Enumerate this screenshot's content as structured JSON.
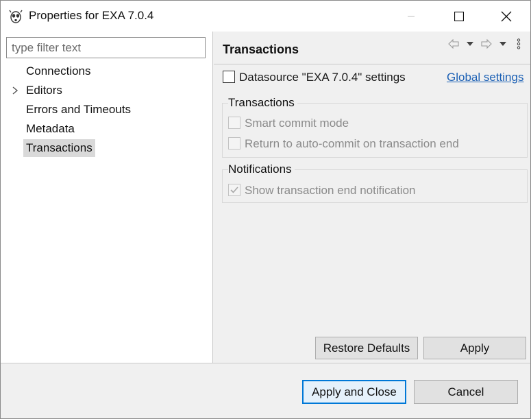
{
  "window": {
    "title": "Properties for EXA 7.0.4",
    "icon": "dbeaver-beaver-icon"
  },
  "filter": {
    "placeholder": "type filter text",
    "value": ""
  },
  "tree": {
    "items": [
      {
        "label": "Connections",
        "expandable": false,
        "selected": false
      },
      {
        "label": "Editors",
        "expandable": true,
        "selected": false
      },
      {
        "label": "Errors and Timeouts",
        "expandable": false,
        "selected": false
      },
      {
        "label": "Metadata",
        "expandable": false,
        "selected": false
      },
      {
        "label": "Transactions",
        "expandable": false,
        "selected": true
      }
    ]
  },
  "page": {
    "title": "Transactions",
    "datasource_checkbox": {
      "label": "Datasource \"EXA 7.0.4\" settings",
      "checked": false
    },
    "global_settings_link": "Global settings",
    "transactions_group": {
      "title": "Transactions",
      "options": [
        {
          "label": "Smart commit mode",
          "checked": false,
          "enabled": false
        },
        {
          "label": "Return to auto-commit on transaction end",
          "checked": false,
          "enabled": false
        }
      ]
    },
    "notifications_group": {
      "title": "Notifications",
      "options": [
        {
          "label": "Show transaction end notification",
          "checked": true,
          "enabled": false
        }
      ]
    },
    "restore_defaults_label": "Restore Defaults",
    "apply_label": "Apply"
  },
  "footer": {
    "apply_close_label": "Apply and Close",
    "cancel_label": "Cancel"
  },
  "colors": {
    "accent": "#0078d7",
    "link": "#1a5fb4",
    "selection": "#d9d9d9"
  }
}
